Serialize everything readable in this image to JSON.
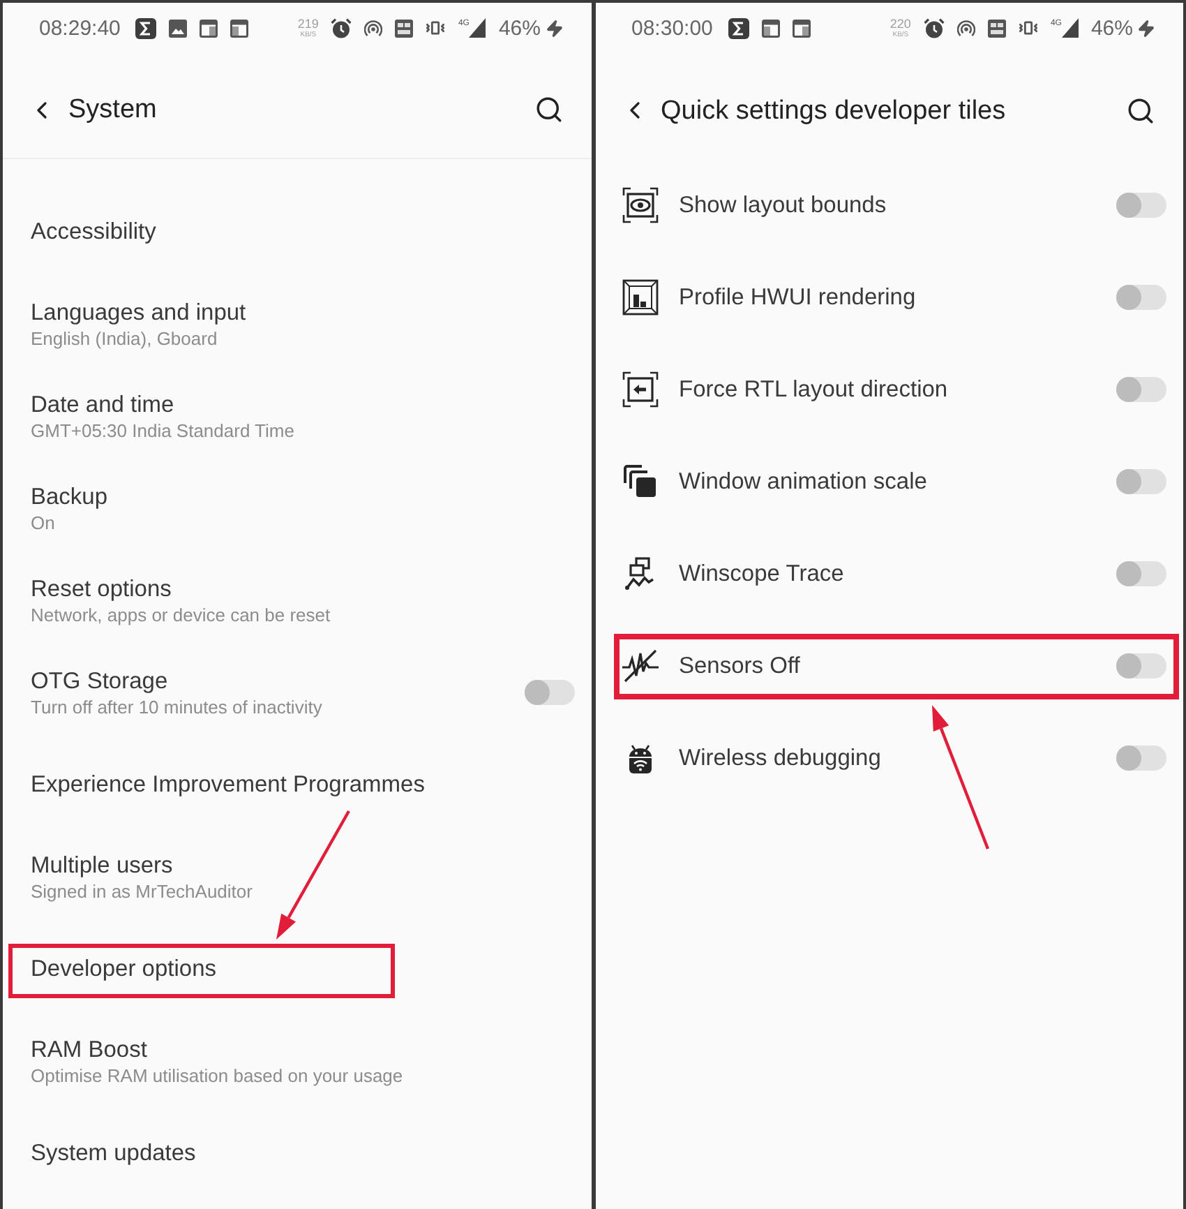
{
  "panels": [
    {
      "status_bar": {
        "time": "08:29:40",
        "speed": {
          "value": "219",
          "unit": "KB/S"
        },
        "network": "4G",
        "battery": "46%"
      },
      "header": {
        "title": "System"
      },
      "items": [
        {
          "kind": "link",
          "title": "Accessibility",
          "highlighted": false
        },
        {
          "kind": "link",
          "title": "Languages and input",
          "subtitle": "English (India), Gboard",
          "highlighted": false
        },
        {
          "kind": "link",
          "title": "Date and time",
          "subtitle": "GMT+05:30 India Standard Time",
          "highlighted": false
        },
        {
          "kind": "link",
          "title": "Backup",
          "subtitle": "On",
          "highlighted": false
        },
        {
          "kind": "link",
          "title": "Reset options",
          "subtitle": "Network, apps or device can be reset",
          "highlighted": false
        },
        {
          "kind": "toggle",
          "title": "OTG Storage",
          "subtitle": "Turn off after 10 minutes of inactivity",
          "on": false,
          "highlighted": false
        },
        {
          "kind": "link",
          "title": "Experience Improvement Programmes",
          "highlighted": false
        },
        {
          "kind": "link",
          "title": "Multiple users",
          "subtitle": "Signed in as MrTechAuditor",
          "highlighted": false
        },
        {
          "kind": "link",
          "title": "Developer options",
          "highlighted": true
        },
        {
          "kind": "link",
          "title": "RAM Boost",
          "subtitle": "Optimise RAM utilisation based on your usage",
          "highlighted": false
        },
        {
          "kind": "link",
          "title": "System updates",
          "highlighted": false
        }
      ]
    },
    {
      "status_bar": {
        "time": "08:30:00",
        "speed": {
          "value": "220",
          "unit": "KB/S"
        },
        "network": "4G",
        "battery": "46%"
      },
      "header": {
        "title": "Quick settings developer tiles"
      },
      "items": [
        {
          "kind": "toggle",
          "title": "Show layout bounds",
          "on": false,
          "highlighted": false
        },
        {
          "kind": "toggle",
          "title": "Profile HWUI rendering",
          "on": false,
          "highlighted": false
        },
        {
          "kind": "toggle",
          "title": "Force RTL layout direction",
          "on": false,
          "highlighted": false
        },
        {
          "kind": "toggle",
          "title": "Window animation scale",
          "on": false,
          "highlighted": false
        },
        {
          "kind": "toggle",
          "title": "Winscope Trace",
          "on": false,
          "highlighted": false
        },
        {
          "kind": "toggle",
          "title": "Sensors Off",
          "on": false,
          "highlighted": true
        },
        {
          "kind": "toggle",
          "title": "Wireless debugging",
          "on": false,
          "highlighted": false
        }
      ]
    }
  ]
}
